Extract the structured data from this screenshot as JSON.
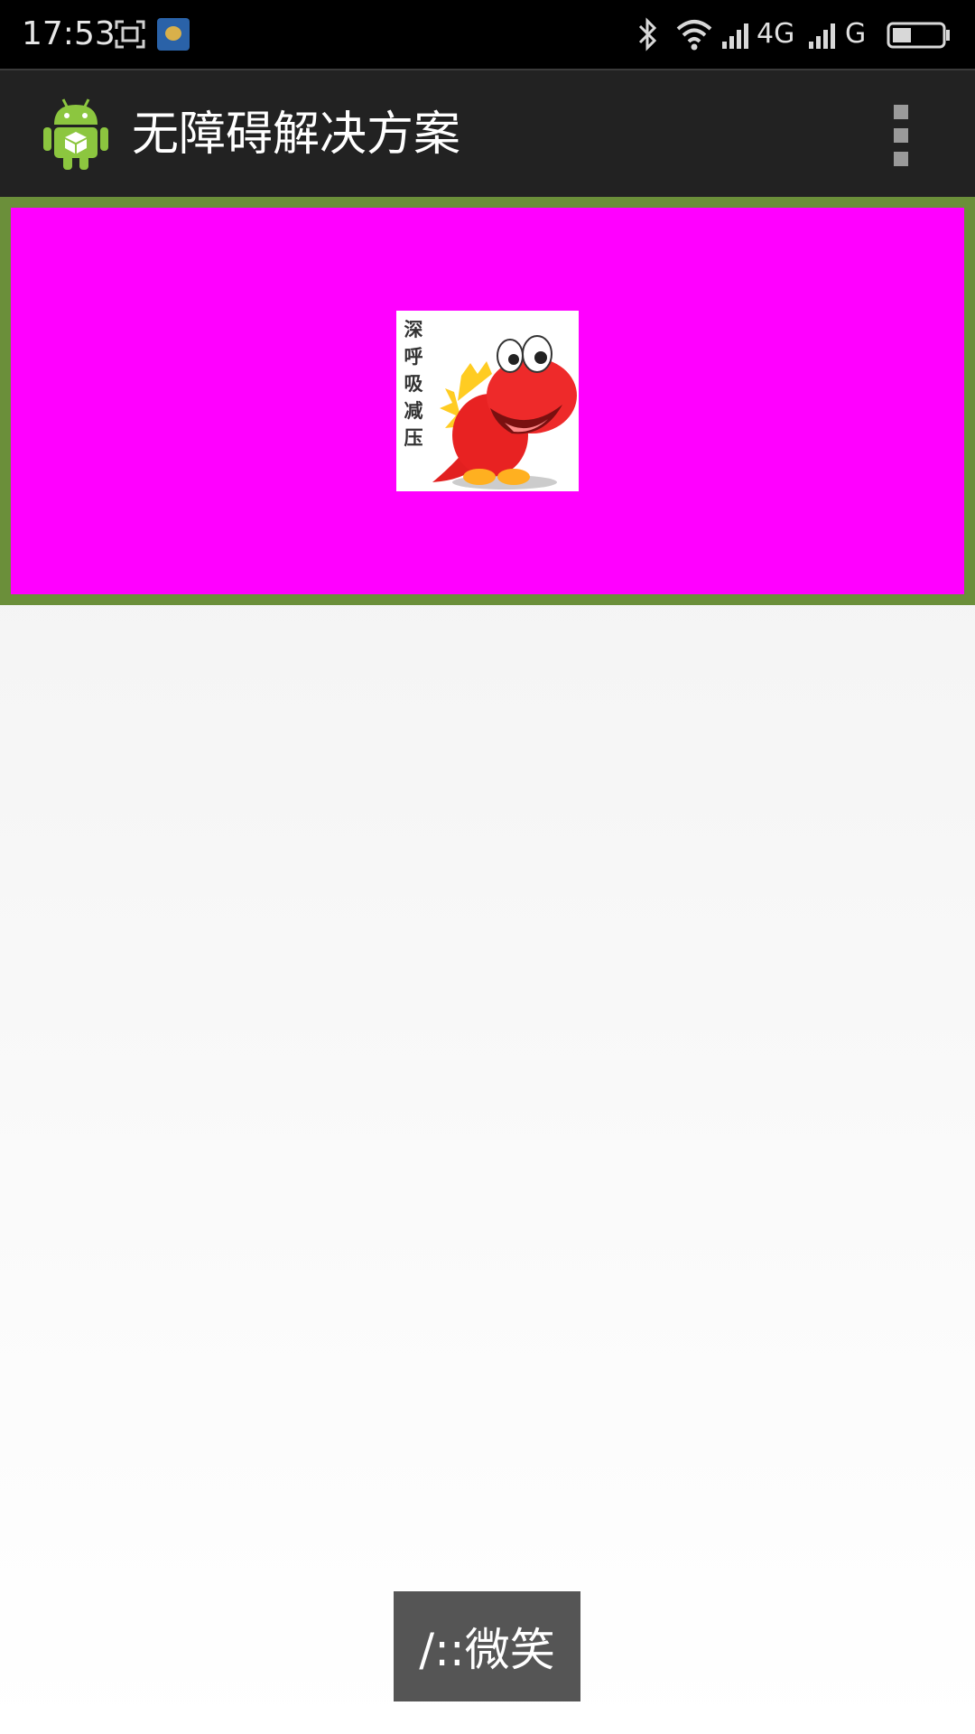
{
  "status_bar": {
    "time": "17:53",
    "network_1": "4G",
    "network_2": "G",
    "icons": [
      "screenshot-icon",
      "app-notification-icon",
      "bluetooth-icon",
      "wifi-icon",
      "signal-icon",
      "signal-icon",
      "battery-icon"
    ]
  },
  "action_bar": {
    "app_icon": "android-robot-icon",
    "title": "无障碍解决方案",
    "overflow_icon": "overflow-menu-icon"
  },
  "banner": {
    "background_color": "#ff00ff",
    "border_color": "#6b8f3a",
    "sticker": {
      "caption": "深呼吸减压",
      "icon": "red-dinosaur-sticker"
    }
  },
  "toast": {
    "text": "/::微笑"
  }
}
